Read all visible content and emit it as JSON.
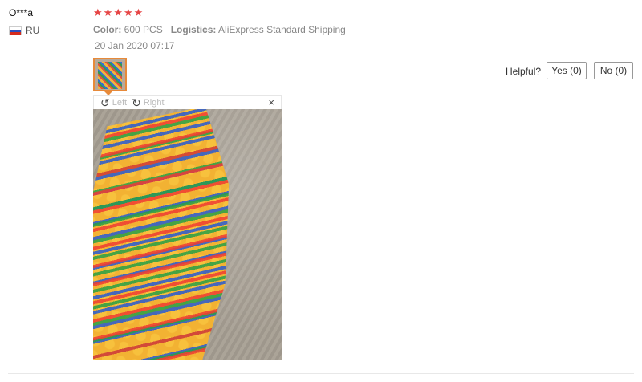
{
  "review": {
    "user": "O***a",
    "country_code": "RU",
    "rating": 5,
    "stars": [
      "★",
      "★",
      "★",
      "★",
      "★"
    ],
    "color_label": "Color:",
    "color_value": "600 PCS",
    "logistics_label": "Logistics:",
    "logistics_value": "AliExpress Standard Shipping",
    "date": "20 Jan 2020 07:17"
  },
  "viewer": {
    "rotate_left_label": "Left",
    "rotate_right_label": "Right",
    "rotate_left_icon": "↺",
    "rotate_right_icon": "↻",
    "close_icon": "×"
  },
  "helpful": {
    "label": "Helpful?",
    "yes_label": "Yes (0)",
    "no_label": "No (0)"
  },
  "colors": {
    "star": "#e64545",
    "thumb_border": "#e78a3a"
  }
}
